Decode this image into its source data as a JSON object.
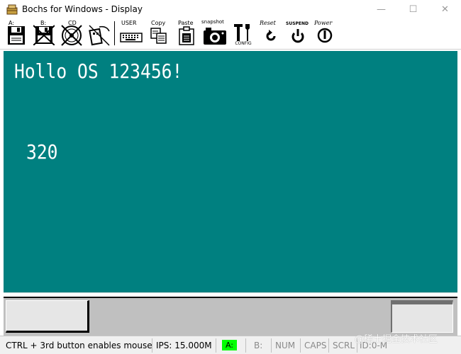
{
  "window": {
    "title": "Bochs for Windows - Display",
    "minimize": "—",
    "maximize": "☐",
    "close": "✕"
  },
  "toolbar": {
    "floppy_a": "A:",
    "floppy_b": "B:",
    "cdrom": "CD",
    "user": "USER",
    "copy": "Copy",
    "paste": "Paste",
    "snapshot": "snapshot",
    "config": "CONFIG",
    "reset": "Reset",
    "suspend": "SUSPEND",
    "power": "Power"
  },
  "screen": {
    "line1": "Hollo OS 123456!",
    "line2": "320",
    "background": "#008080",
    "text_color": "#ffffff"
  },
  "statusbar": {
    "mouse_hint": "CTRL + 3rd button enables mouse",
    "ips": "IPS: 15.000M",
    "drive_a": "A:",
    "drive_b": "B:",
    "num": "NUM",
    "caps": "CAPS",
    "scrl": "SCRL",
    "id": "ID:0-M",
    "active_color": "#00ff00"
  },
  "watermark": "@稀土掘金技术社区"
}
